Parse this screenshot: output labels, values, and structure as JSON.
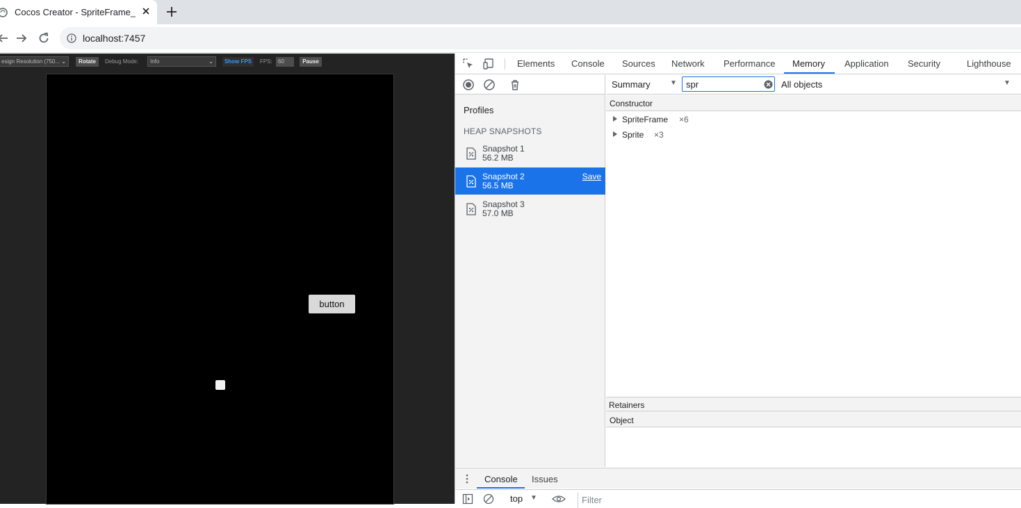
{
  "browser": {
    "tab_title": "Cocos Creator - SpriteFrame_T",
    "url": "localhost:7457",
    "icons": [
      "chrome-favicon-icon",
      "close-icon",
      "plus-icon",
      "back-arrow-icon",
      "forward-arrow-icon",
      "reload-icon",
      "info-icon"
    ]
  },
  "preview": {
    "design_resolution": "esign Resolution (750...",
    "rotate_label": "Rotate",
    "debug_mode_label": "Debug Mode:",
    "debug_mode_value": "Info",
    "show_fps_label": "Show FPS",
    "fps_label": "FPS:",
    "fps_value": "60",
    "pause_label": "Pause",
    "game_button_label": "button"
  },
  "devtools": {
    "tabs": [
      "Elements",
      "Console",
      "Sources",
      "Network",
      "Performance",
      "Memory",
      "Application",
      "Security",
      "Lighthouse"
    ],
    "active_tab": "Memory",
    "profiles_title": "Profiles",
    "heap_snapshots_title": "HEAP SNAPSHOTS",
    "snapshots": [
      {
        "name": "Snapshot 1",
        "size": "56.2 MB"
      },
      {
        "name": "Snapshot 2",
        "size": "56.5 MB"
      },
      {
        "name": "Snapshot 3",
        "size": "57.0 MB"
      }
    ],
    "selected_snapshot": 1,
    "save_label": "Save",
    "view_select": "Summary",
    "class_filter_value": "spr",
    "objects_select": "All objects",
    "constructor_header": "Constructor",
    "constructors": [
      {
        "name": "SpriteFrame",
        "count": "×6"
      },
      {
        "name": "Sprite",
        "count": "×3"
      }
    ],
    "retainers_label": "Retainers",
    "object_header": "Object",
    "drawer_tabs": [
      "Console",
      "Issues"
    ],
    "drawer_active": "Console",
    "console_context": "top",
    "console_filter_placeholder": "Filter",
    "accent_color": "#1a73e8"
  }
}
